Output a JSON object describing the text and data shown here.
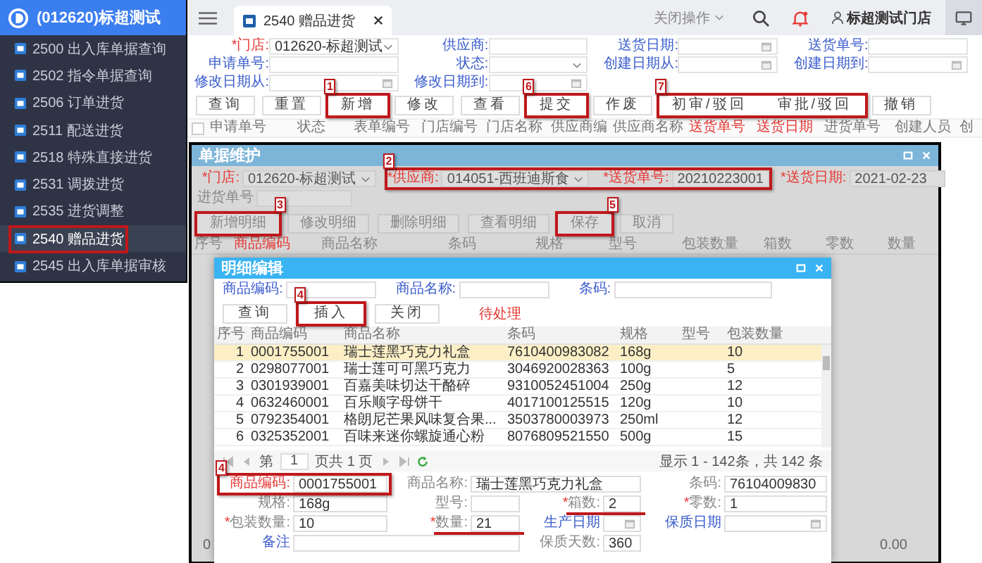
{
  "sidebar": {
    "title": "(012620)标超测试",
    "items": [
      {
        "label": "2500 出入库单据查询",
        "selected": false,
        "highlighted": false
      },
      {
        "label": "2502 指令单据查询",
        "selected": false,
        "highlighted": false
      },
      {
        "label": "2506 订单进货",
        "selected": false,
        "highlighted": false
      },
      {
        "label": "2511 配送进货",
        "selected": false,
        "highlighted": false
      },
      {
        "label": "2518 特殊直接进货",
        "selected": false,
        "highlighted": false
      },
      {
        "label": "2531 调拨进货",
        "selected": false,
        "highlighted": false
      },
      {
        "label": "2535 进货调整",
        "selected": false,
        "highlighted": false
      },
      {
        "label": "2540 赠品进货",
        "selected": true,
        "highlighted": true
      },
      {
        "label": "2545 出入库单据审核",
        "selected": false,
        "highlighted": false
      }
    ]
  },
  "topbar": {
    "tab": "2540 赠品进货",
    "close_menu": "关闭操作",
    "user": "标超测试门店"
  },
  "filters": [
    {
      "mark": "*",
      "label": "门店:",
      "kind": "select",
      "value": "012620-标超测试",
      "color": "#e53935"
    },
    {
      "label": "供应商:",
      "kind": "text",
      "color": "#3a5ccc"
    },
    {
      "label": "送货日期:",
      "kind": "date",
      "color": "#3a5ccc"
    },
    {
      "label": "送货单号:",
      "kind": "text",
      "color": "#3a5ccc"
    },
    {
      "label": "申请单号:",
      "kind": "text",
      "color": "#3a5ccc"
    },
    {
      "label": "状态:",
      "kind": "select",
      "color": "#3a5ccc"
    },
    {
      "label": "创建日期从:",
      "kind": "date",
      "color": "#3a5ccc"
    },
    {
      "label": "创建日期到:",
      "kind": "date",
      "color": "#3a5ccc"
    },
    {
      "label": "修改日期从:",
      "kind": "date",
      "color": "#3a5ccc"
    },
    {
      "label": "修改日期到:",
      "kind": "date",
      "color": "#3a5ccc"
    }
  ],
  "toolbar": [
    {
      "label": "查询"
    },
    {
      "label": "重置"
    },
    {
      "label": "新增",
      "annotation": "1"
    },
    {
      "label": "修改"
    },
    {
      "label": "查看"
    },
    {
      "label": "提交",
      "annotation": "6"
    },
    {
      "label": "作废"
    },
    {
      "annotation": "7",
      "buttons": [
        {
          "label": "初审/驳回"
        },
        {
          "label": "审批/驳回"
        }
      ]
    },
    {
      "label": "撤销"
    }
  ],
  "table": {
    "select_all": {
      "checked": false
    },
    "columns": [
      {
        "label": "申请单号",
        "color": "#777777"
      },
      {
        "label": "状态",
        "color": "#777777"
      },
      {
        "label": "表单编号",
        "color": "#777777"
      },
      {
        "label": "门店编号",
        "color": "#777777"
      },
      {
        "label": "门店名称",
        "color": "#777777"
      },
      {
        "label": "供应商编",
        "color": "#777777"
      },
      {
        "label": "供应商名称",
        "color": "#777777"
      },
      {
        "label": "送货单号",
        "color": "#e53935"
      },
      {
        "label": "送货日期",
        "color": "#e53935"
      },
      {
        "label": "进货单号",
        "color": "#777777"
      },
      {
        "label": "创建人员",
        "color": "#777777"
      },
      {
        "label": "创",
        "color": "#777777"
      }
    ]
  },
  "maintenance": {
    "title": "单据维护",
    "fields": [
      {
        "mark": "*",
        "label": "门店:",
        "kind": "select",
        "value": "012620-标超测试",
        "color": "#e53935"
      },
      {
        "annotation": "2",
        "fields": [
          {
            "mark": "*",
            "label": "供应商:",
            "kind": "select",
            "value": "014051-西班迪斯食",
            "color": "#e53935"
          },
          {
            "mark": "*",
            "label": "送货单号:",
            "kind": "text",
            "value": "20210223001",
            "color": "#e53935"
          }
        ]
      },
      {
        "mark": "*",
        "label": "送货日期:",
        "kind": "text",
        "value": "2021-02-23",
        "color": "#e53935"
      },
      {
        "label": "进货单号",
        "kind": "text",
        "color": "#888888"
      }
    ],
    "buttons": [
      {
        "label": "新增明细",
        "annotation": "3"
      },
      {
        "label": "修改明细"
      },
      {
        "label": "删除明细"
      },
      {
        "label": "查看明细"
      },
      {
        "label": "保存",
        "annotation": "5"
      },
      {
        "label": "取消"
      }
    ],
    "columns": [
      {
        "label": "序号",
        "color": "#888888"
      },
      {
        "label": "商品编码",
        "color": "#e53935"
      },
      {
        "label": "商品名称",
        "color": "#888888"
      },
      {
        "label": "条码",
        "color": "#888888"
      },
      {
        "label": "规格",
        "color": "#888888"
      },
      {
        "label": "型号",
        "color": "#888888"
      },
      {
        "label": "包装数量",
        "color": "#888888"
      },
      {
        "label": "箱数",
        "color": "#888888"
      },
      {
        "label": "零数",
        "color": "#888888"
      },
      {
        "label": "数量",
        "color": "#888888"
      }
    ],
    "footer": {
      "count": "0",
      "total": "0.00"
    }
  },
  "detail": {
    "title": "明细编辑",
    "search": [
      {
        "label": "商品编码:",
        "color": "#3a5ccc"
      },
      {
        "label": "商品名称:",
        "color": "#3a5ccc"
      },
      {
        "label": "条码:",
        "color": "#3a5ccc"
      }
    ],
    "buttons": [
      {
        "label": "查询"
      },
      {
        "label": "插入",
        "annotation": "4"
      },
      {
        "label": "关闭"
      }
    ],
    "status": "待处理",
    "columns": [
      "序号",
      "商品编码",
      "商品名称",
      "条码",
      "规格",
      "型号",
      "包装数量"
    ],
    "rows": [
      {
        "no": "1",
        "code": "0001755001",
        "name": "瑞士莲黑巧克力礼盒",
        "barcode": "7610400983082",
        "spec": "168g",
        "pack": "10",
        "selected": true
      },
      {
        "no": "2",
        "code": "0298077001",
        "name": "瑞士莲可可黑巧克力",
        "barcode": "3046920028363",
        "spec": "100g",
        "pack": "5",
        "selected": false
      },
      {
        "no": "3",
        "code": "0301939001",
        "name": "百嘉美味切达干酪碎",
        "barcode": "9310052451004",
        "spec": "250g",
        "pack": "12",
        "selected": false
      },
      {
        "no": "4",
        "code": "0632460001",
        "name": "百乐顺字母饼干",
        "barcode": "4017100125515",
        "spec": "120g",
        "pack": "10",
        "selected": false
      },
      {
        "no": "5",
        "code": "0792354001",
        "name": "格朗尼芒果风味复合果...",
        "barcode": "3503780003973",
        "spec": "250ml",
        "pack": "12",
        "selected": false
      },
      {
        "no": "6",
        "code": "0325352001",
        "name": "百味来迷你螺旋通心粉",
        "barcode": "8076809521550",
        "spec": "500g",
        "pack": "15",
        "selected": false
      }
    ],
    "pager": {
      "page_label": "第",
      "page": "1",
      "of": "页共 1 页",
      "summary": "显示 1 - 142条，共 142 条"
    },
    "form": [
      {
        "label": "商品编码:",
        "color": "#e53935",
        "kind": "text",
        "value": "0001755001",
        "annotation": "4"
      },
      {
        "label": "商品名称:",
        "color": "#888888",
        "kind": "wide",
        "value": "瑞士莲黑巧克力礼盒"
      },
      {
        "label": "条码:",
        "color": "#888888",
        "kind": "text",
        "value": "76104009830"
      },
      {
        "label": "规格:",
        "color": "#888888",
        "kind": "text",
        "value": "168g"
      },
      {
        "label": "型号:",
        "color": "#888888",
        "kind": "text"
      },
      {
        "mark": "*",
        "label": "箱数:",
        "color": "#888888",
        "kind": "text",
        "value": "2",
        "underlined": true
      },
      {
        "mark": "*",
        "label": "零数:",
        "color": "#888888",
        "kind": "text",
        "value": "1"
      },
      {
        "mark": "*",
        "label": "包装数量:",
        "color": "#888888",
        "kind": "text",
        "value": "10"
      },
      {
        "mark": "*",
        "label": "数量:",
        "color": "#888888",
        "kind": "text",
        "value": "21",
        "underlined": true
      },
      {
        "label": "生产日期",
        "color": "#3a5ccc",
        "kind": "date"
      },
      {
        "label": "保质日期",
        "color": "#3a5ccc",
        "kind": "date"
      },
      {
        "label": "备注",
        "color": "#3a5ccc",
        "kind": "wide"
      },
      {
        "label": "保质天数:",
        "color": "#888888",
        "kind": "text",
        "value": "360"
      }
    ]
  }
}
